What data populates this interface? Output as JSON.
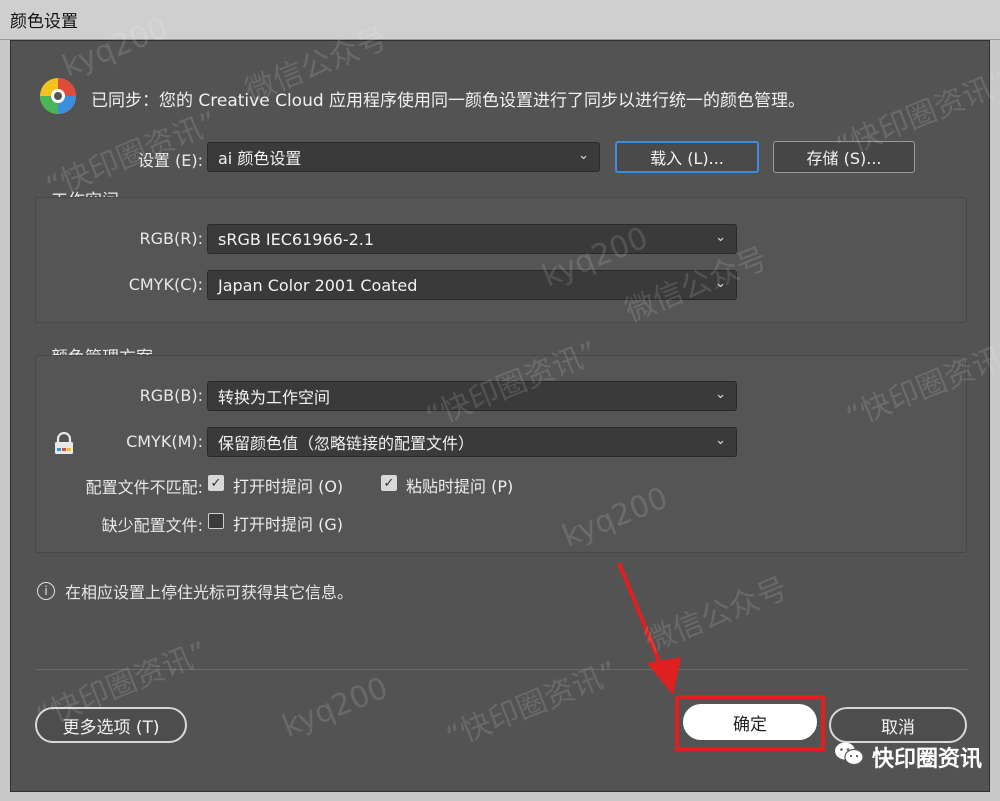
{
  "window": {
    "title": "颜色设置"
  },
  "sync": {
    "text": "已同步：您的 Creative Cloud 应用程序使用同一颜色设置进行了同步以进行统一的颜色管理。"
  },
  "settings": {
    "label": "设置 (E):",
    "value": "ai 颜色设置",
    "load_label": "载入 (L)...",
    "save_label": "存储 (S)..."
  },
  "workspace": {
    "title": "工作空间",
    "rgb_label": "RGB(R):",
    "rgb_value": "sRGB IEC61966-2.1",
    "cmyk_label": "CMYK(C):",
    "cmyk_value": "Japan Color 2001 Coated"
  },
  "policy": {
    "title": "颜色管理方案",
    "rgb_label": "RGB(B):",
    "rgb_value": "转换为工作空间",
    "cmyk_label": "CMYK(M):",
    "cmyk_value": "保留颜色值（忽略链接的配置文件）",
    "mismatch_label": "配置文件不匹配:",
    "mismatch_open_label": "打开时提问 (O)",
    "mismatch_open_checked": true,
    "mismatch_paste_label": "粘贴时提问 (P)",
    "mismatch_paste_checked": true,
    "missing_label": "缺少配置文件:",
    "missing_open_label": "打开时提问 (G)",
    "missing_open_checked": false
  },
  "info": {
    "text": "在相应设置上停住光标可获得其它信息。"
  },
  "footer": {
    "more_options_label": "更多选项 (T)",
    "ok_label": "确定",
    "cancel_label": "取消"
  },
  "watermark": {
    "brand": "快印圈资讯",
    "tiles": [
      "kyq200",
      "微信公众号",
      "“快印圈资讯”"
    ]
  },
  "colors": {
    "dialog_bg": "#535353",
    "highlight": "#e02020",
    "accent": "#3d8ce0"
  }
}
